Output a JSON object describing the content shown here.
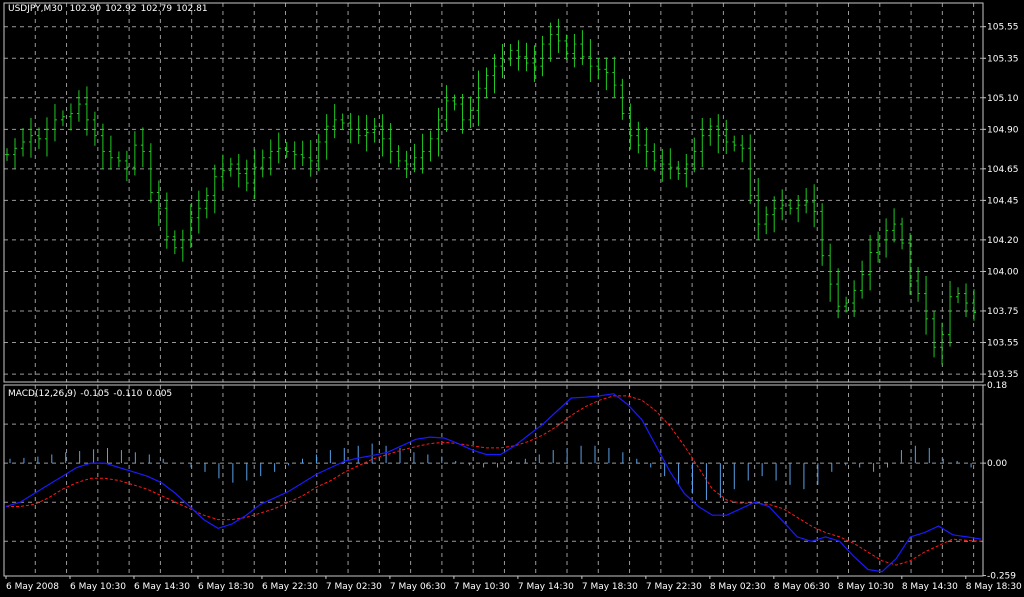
{
  "window": {
    "symbol_label": "USDJPY,M30",
    "ohlc": [
      "102.90",
      "102.92",
      "102.79",
      "102.81"
    ]
  },
  "indicator": {
    "label": "MACD(12,26,9)",
    "values": [
      "-0.105",
      "-0.110",
      "0.005"
    ]
  },
  "colors": {
    "background": "#000000",
    "grid": "#9a9a9a",
    "frame": "#c8c8c8",
    "price_bars": "#22c922",
    "macd_line": "#1a1aff",
    "signal_line": "#ff1a1a",
    "histogram": "#5aa0e6"
  },
  "chart_data": [
    {
      "type": "line",
      "subtype": "ohlc-bars",
      "title": "USDJPY,M30",
      "y_axis_ticks": [
        "105.55",
        "105.35",
        "105.10",
        "104.90",
        "104.65",
        "104.45",
        "104.20",
        "104.00",
        "103.75",
        "103.55",
        "103.35"
      ],
      "ylim": [
        103.3,
        105.7
      ],
      "x_tick_labels": [
        "6 May 2008",
        "6 May 10:30",
        "6 May 14:30",
        "6 May 18:30",
        "6 May 22:30",
        "7 May 02:30",
        "7 May 06:30",
        "7 May 10:30",
        "7 May 14:30",
        "7 May 18:30",
        "7 May 22:30",
        "8 May 02:30",
        "8 May 06:30",
        "8 May 10:30",
        "8 May 14:30",
        "8 May 18:30"
      ],
      "grid": true,
      "approx_close": [
        104.74,
        104.78,
        104.82,
        104.86,
        104.84,
        104.9,
        104.96,
        104.98,
        105.0,
        105.06,
        104.96,
        104.86,
        104.76,
        104.72,
        104.7,
        104.66,
        104.8,
        104.76,
        104.5,
        104.4,
        104.22,
        104.15,
        104.2,
        104.34,
        104.4,
        104.48,
        104.6,
        104.64,
        104.68,
        104.62,
        104.56,
        104.66,
        104.72,
        104.76,
        104.78,
        104.76,
        104.74,
        104.72,
        104.7,
        104.82,
        104.92,
        104.96,
        104.94,
        104.9,
        104.86,
        104.88,
        104.92,
        104.84,
        104.76,
        104.7,
        104.68,
        104.72,
        104.76,
        104.84,
        104.96,
        105.08,
        105.06,
        104.96,
        105.02,
        105.16,
        105.24,
        105.3,
        105.34,
        105.4,
        105.36,
        105.32,
        105.3,
        105.44,
        105.5,
        105.46,
        105.38,
        105.44,
        105.36,
        105.3,
        105.28,
        105.26,
        105.18,
        105.0,
        104.86,
        104.8,
        104.76,
        104.7,
        104.68,
        104.66,
        104.62,
        104.68,
        104.76,
        104.86,
        104.92,
        104.86,
        104.82,
        104.8,
        104.78,
        104.48,
        104.3,
        104.36,
        104.4,
        104.42,
        104.4,
        104.42,
        104.44,
        104.38,
        104.1,
        103.92,
        103.78,
        103.8,
        103.88,
        103.98,
        104.12,
        104.2,
        104.26,
        104.3,
        104.18,
        103.94,
        103.86,
        103.7,
        103.52,
        103.6,
        103.84,
        103.86,
        103.8,
        103.74
      ],
      "bars_count": 122
    },
    {
      "type": "line",
      "title": "MACD(12,26,9)",
      "y_axis_ticks": [
        "0.18",
        "0.00",
        "-0.259"
      ],
      "ylim": [
        -0.26,
        0.18
      ],
      "series": [
        {
          "name": "MACD",
          "values": [
            -0.1,
            -0.09,
            -0.07,
            -0.05,
            -0.03,
            -0.01,
            0.0,
            0.0,
            -0.01,
            -0.02,
            -0.03,
            -0.045,
            -0.07,
            -0.1,
            -0.13,
            -0.15,
            -0.14,
            -0.12,
            -0.095,
            -0.08,
            -0.065,
            -0.045,
            -0.025,
            -0.01,
            0.005,
            0.012,
            0.018,
            0.025,
            0.04,
            0.055,
            0.06,
            0.058,
            0.045,
            0.03,
            0.02,
            0.02,
            0.04,
            0.065,
            0.09,
            0.12,
            0.15,
            0.152,
            0.155,
            0.16,
            0.135,
            0.1,
            0.04,
            -0.02,
            -0.07,
            -0.1,
            -0.12,
            -0.12,
            -0.105,
            -0.09,
            -0.1,
            -0.135,
            -0.17,
            -0.18,
            -0.17,
            -0.18,
            -0.215,
            -0.245,
            -0.25,
            -0.22,
            -0.17,
            -0.16,
            -0.145,
            -0.165,
            -0.17,
            -0.175
          ]
        },
        {
          "name": "Signal",
          "values": [
            -0.1,
            -0.1,
            -0.095,
            -0.08,
            -0.06,
            -0.045,
            -0.035,
            -0.035,
            -0.04,
            -0.05,
            -0.06,
            -0.075,
            -0.09,
            -0.105,
            -0.12,
            -0.13,
            -0.13,
            -0.125,
            -0.115,
            -0.105,
            -0.09,
            -0.075,
            -0.055,
            -0.04,
            -0.02,
            -0.005,
            0.01,
            0.02,
            0.03,
            0.038,
            0.045,
            0.048,
            0.045,
            0.04,
            0.035,
            0.035,
            0.04,
            0.05,
            0.065,
            0.085,
            0.11,
            0.13,
            0.145,
            0.155,
            0.155,
            0.145,
            0.12,
            0.085,
            0.04,
            -0.01,
            -0.06,
            -0.085,
            -0.092,
            -0.092,
            -0.095,
            -0.105,
            -0.125,
            -0.145,
            -0.16,
            -0.17,
            -0.185,
            -0.205,
            -0.225,
            -0.235,
            -0.225,
            -0.205,
            -0.19,
            -0.175,
            -0.178,
            -0.18
          ]
        }
      ],
      "histogram": [
        0.01,
        0.012,
        0.015,
        0.02,
        0.025,
        0.028,
        0.032,
        0.035,
        0.03,
        0.025,
        0.02,
        0.01,
        0.0,
        -0.01,
        -0.02,
        -0.035,
        -0.045,
        -0.04,
        -0.03,
        -0.02,
        -0.005,
        0.01,
        0.02,
        0.03,
        0.035,
        0.04,
        0.045,
        0.04,
        0.035,
        0.025,
        0.02,
        0.015,
        0.005,
        -0.005,
        -0.01,
        -0.01,
        0.005,
        0.01,
        0.02,
        0.03,
        0.035,
        0.04,
        0.04,
        0.035,
        0.025,
        0.01,
        -0.01,
        -0.03,
        -0.05,
        -0.07,
        -0.085,
        -0.08,
        -0.06,
        -0.04,
        -0.03,
        -0.04,
        -0.05,
        -0.06,
        -0.05,
        -0.02,
        -0.005,
        -0.01,
        -0.02,
        -0.01,
        0.03,
        0.04,
        0.035,
        0.01,
        0.005,
        -0.01
      ],
      "grid": true
    }
  ]
}
